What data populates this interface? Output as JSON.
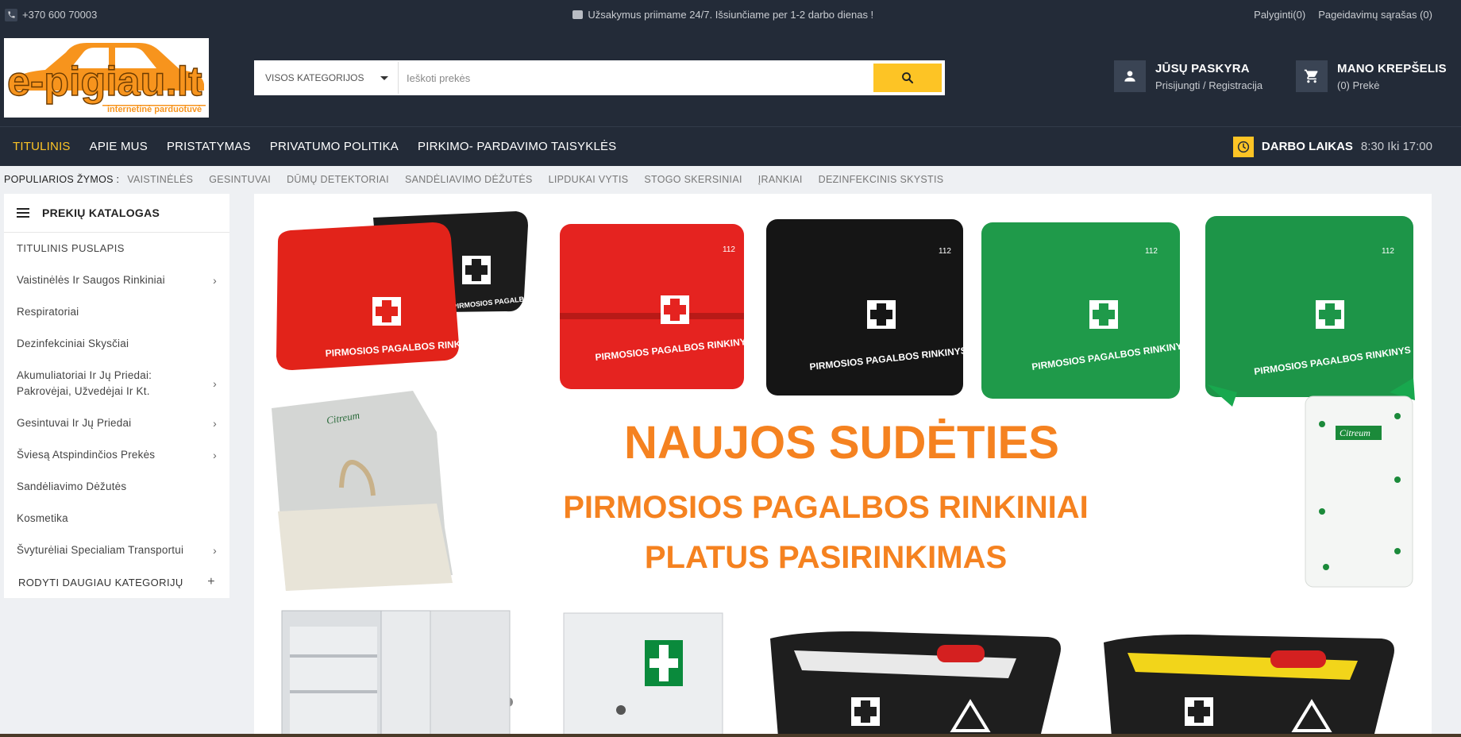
{
  "topbar": {
    "phone": "+370 600 70003",
    "notice": "Užsakymus priimame 24/7. Išsiunčiame per 1-2 darbo dienas !",
    "compare": "Palyginti(0)",
    "wishlist": "Pageidavimų sąrašas (0)"
  },
  "header": {
    "logo_text": "e-pigiau.lt",
    "logo_subtitle": "internetinė parduotuvė",
    "search_category": "VISOS KATEGORIJOS",
    "search_placeholder": "Ieškoti prekės",
    "account_title": "JŪSŲ PASKYRA",
    "account_sub": "Prisijungti / Registracija",
    "cart_title": "MANO KREPŠELIS",
    "cart_sub": "(0) Prekė"
  },
  "nav": {
    "items": [
      "TITULINIS",
      "APIE MUS",
      "PRISTATYMAS",
      "PRIVATUMO POLITIKA",
      "PIRKIMO- PARDAVIMO TAISYKLĖS"
    ],
    "hours_label": "DARBO LAIKAS",
    "hours_value": "8:30 Iki 17:00"
  },
  "tags": {
    "label": "POPULIARIOS ŽYMOS :",
    "items": [
      "VAISTINĖLĖS",
      "GESINTUVAI",
      "DŪMŲ DETEKTORIAI",
      "SANDĖLIAVIMO DĖŽUTĖS",
      "LIPDUKAI VYTIS",
      "STOGO SKERSINIAI",
      "ĮRANKIAI",
      "DEZINFEKCINIS SKYSTIS"
    ]
  },
  "sidebar": {
    "title": "PREKIŲ KATALOGAS",
    "items": [
      {
        "label": "TITULINIS PUSLAPIS"
      },
      {
        "label": "Vaistinėlės Ir Saugos Rinkiniai"
      },
      {
        "label": "Respiratoriai"
      },
      {
        "label": "Dezinfekciniai Skysčiai"
      },
      {
        "label": "Akumuliatoriai Ir Jų Priedai: Pakrovėjai, Užvedėjai Ir Kt."
      },
      {
        "label": "Gesintuvai Ir Jų Priedai"
      },
      {
        "label": "Šviesą Atspindinčios Prekės"
      },
      {
        "label": "Sandėliavimo Dėžutės"
      },
      {
        "label": "Kosmetika"
      },
      {
        "label": "Švyturėliai Specialiam Transportui"
      }
    ],
    "more": "RODYTI DAUGIAU KATEGORIJŲ"
  },
  "banner": {
    "headline": "NAUJOS SUDĖTIES",
    "line2": "PIRMOSIOS PAGALBOS RINKINIAI",
    "line3": "PLATUS PASIRINKIMAS",
    "kit_label": "PIRMOSIOS PAGALBOS RINKINYS",
    "brand": "Citreum",
    "emergency": "112"
  },
  "colors": {
    "dark": "#232b38",
    "accent": "#fdc425",
    "banner_orange": "#f58220"
  }
}
